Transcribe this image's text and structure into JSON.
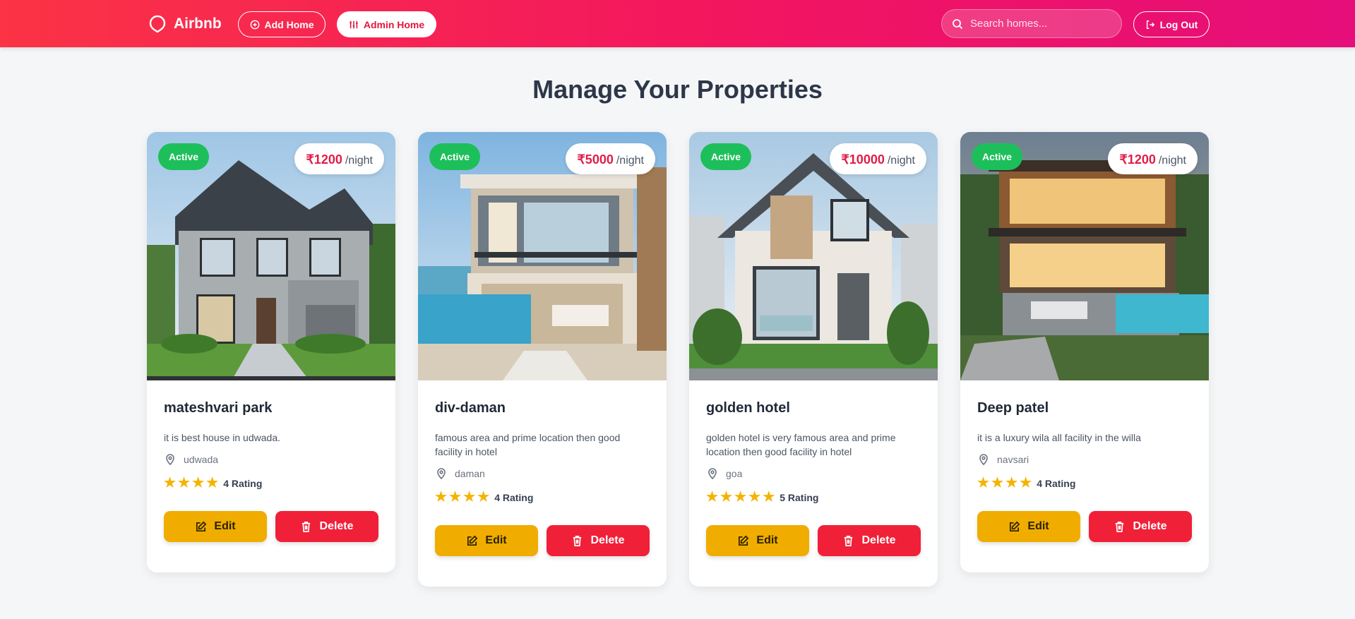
{
  "nav": {
    "brand": "Airbnb",
    "add_home": "Add Home",
    "admin_home": "Admin Home",
    "search_placeholder": "Search homes...",
    "logout": "Log Out"
  },
  "page": {
    "title": "Manage Your Properties"
  },
  "colors": {
    "accent": "#f21560",
    "active_badge": "#1dbf5a",
    "edit": "#f0ad00",
    "delete": "#f02038",
    "star": "#f5b301"
  },
  "cards": [
    {
      "status": "Active",
      "price": "₹1200",
      "unit": "/night",
      "title": "mateshvari park",
      "description": "it is best house in udwada.",
      "location": "udwada",
      "rating": 4,
      "rating_text": "4 Rating",
      "edit": "Edit",
      "delete": "Delete"
    },
    {
      "status": "Active",
      "price": "₹5000",
      "unit": "/night",
      "title": "div-daman",
      "description": "famous area and prime location then good facility in hotel",
      "location": "daman",
      "rating": 4,
      "rating_text": "4 Rating",
      "edit": "Edit",
      "delete": "Delete"
    },
    {
      "status": "Active",
      "price": "₹10000",
      "unit": "/night",
      "title": "golden hotel",
      "description": "golden hotel is very famous area and prime location then good facility in hotel",
      "location": "goa",
      "rating": 5,
      "rating_text": "5 Rating",
      "edit": "Edit",
      "delete": "Delete"
    },
    {
      "status": "Active",
      "price": "₹1200",
      "unit": "/night",
      "title": "Deep patel",
      "description": "it is a luxury wila all facility in the willa",
      "location": "navsari",
      "rating": 4,
      "rating_text": "4 Rating",
      "edit": "Edit",
      "delete": "Delete"
    }
  ]
}
